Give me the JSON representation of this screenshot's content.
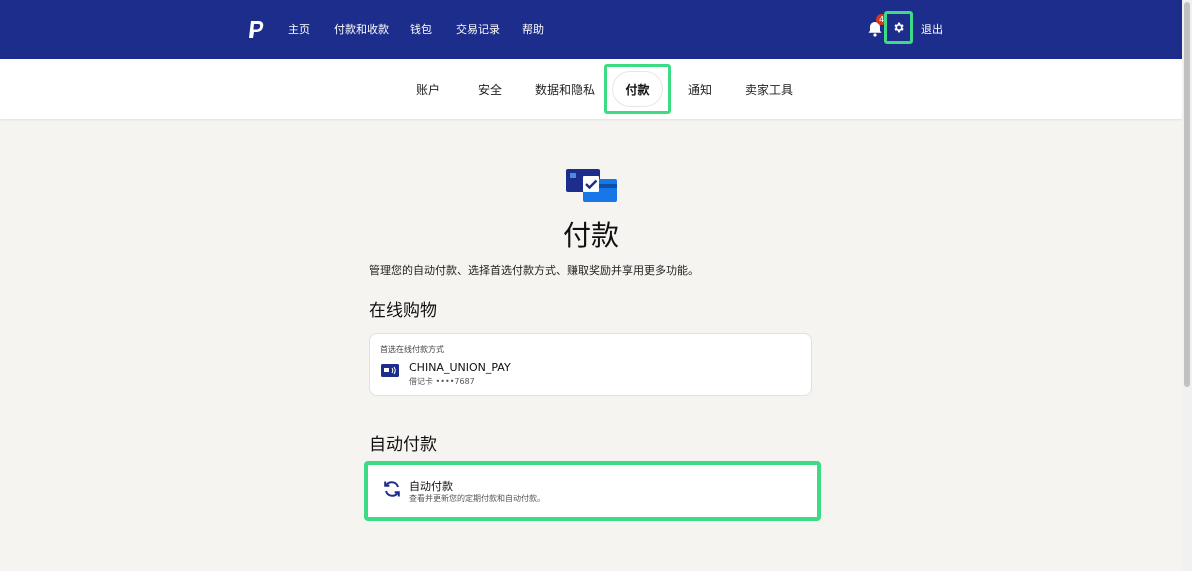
{
  "topnav": {
    "links": [
      "主页",
      "付款和收款",
      "钱包",
      "交易记录",
      "帮助"
    ],
    "notification_count": "4",
    "logout_label": "退出"
  },
  "subnav": {
    "tabs": [
      "账户",
      "安全",
      "数据和隐私",
      "付款",
      "通知",
      "卖家工具"
    ],
    "active_tab": "付款"
  },
  "main": {
    "title": "付款",
    "subtitle": "管理您的自动付款、选择首选付款方式、赚取奖励并享用更多功能。",
    "online_shopping": {
      "heading": "在线购物",
      "caption": "首选在线付款方式",
      "card_name": "CHINA_UNION_PAY",
      "card_detail": "借记卡 ••••7687"
    },
    "auto_pay": {
      "heading": "自动付款",
      "item_title": "自动付款",
      "item_desc": "查看并更新您的定期付款和自动付款。"
    }
  },
  "colors": {
    "brand_blue": "#1d2d8c",
    "highlight_green": "#3ddc84",
    "badge_red": "#d9361e",
    "background": "#f5f4f1"
  },
  "icons": [
    "paypal-logo",
    "bell-icon",
    "gear-icon",
    "payment-cards-icon",
    "bank-card-icon",
    "refresh-icon"
  ]
}
